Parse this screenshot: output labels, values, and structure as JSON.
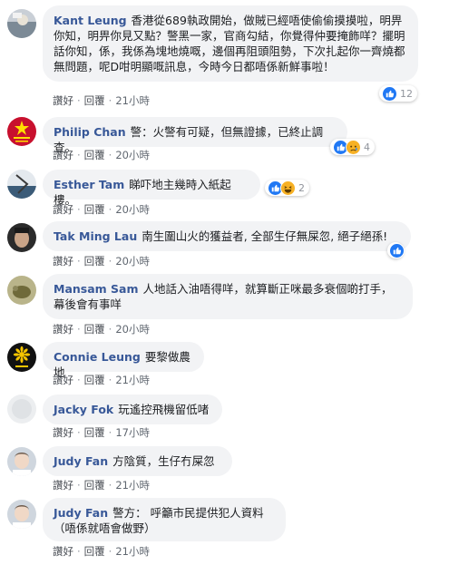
{
  "colors": {
    "name": "#385898",
    "bubble": "#f2f3f5",
    "meta": "#606770",
    "like_blue": "#2078f4",
    "haha_yellow": "#f7b125"
  },
  "actions": {
    "like": "讚好",
    "reply": "回覆",
    "dot": "·"
  },
  "comments": [
    {
      "author": "Kant Leung",
      "text": "香港從689執政開始，做賊已經唔使偷偷摸摸啦，明畀你知，明畀你見又點？警黑一家，官商勾結，你覺得仲要掩飾咩？擺明話你知，係，我係為塊地燒嘅，邊個再阻頭阻勢，下次扎起你一齊燒都無問題，呢D咁明顯嘅訊息，今時今日都唔係新鮮事啦！",
      "time": "21小時",
      "reaction_icons": [
        "like-icon"
      ],
      "reaction_count": "12"
    },
    {
      "author": "Philip Chan",
      "text": "警：火警有可疑，但無證據，已終止調查。",
      "time": "20小時",
      "reaction_icons": [
        "like-icon",
        "sad-icon"
      ],
      "reaction_count": "4"
    },
    {
      "author": "Esther Tam",
      "text": "睇吓地主幾時入紙起樓。",
      "time": "20小時",
      "reaction_icons": [
        "like-icon",
        "haha-icon"
      ],
      "reaction_count": "2"
    },
    {
      "author": "Tak Ming Lau",
      "text": "南生圍山火的獲益者, 全部生仔無屎忽, 絕子絕孫!",
      "time": "20小時",
      "reaction_icons": [
        "like-icon"
      ],
      "reaction_count": ""
    },
    {
      "author": "Mansam Sam",
      "text": "人地話入油唔得咩，就算斷正咪最多衰個啲打手，幕後會有事咩",
      "time": "20小時",
      "reaction_icons": [],
      "reaction_count": ""
    },
    {
      "author": "Connie Leung",
      "text": "要黎做農地",
      "time": "21小時",
      "reaction_icons": [],
      "reaction_count": ""
    },
    {
      "author": "Jacky Fok",
      "text": "玩遙控飛機留低啫",
      "time": "17小時",
      "reaction_icons": [],
      "reaction_count": ""
    },
    {
      "author": "Judy Fan",
      "text": "方陰質，生仔冇屎忽",
      "time": "21小時",
      "reaction_icons": [],
      "reaction_count": ""
    },
    {
      "author": "Judy Fan",
      "text": "警方： 呼籲市民提供犯人資料\n（唔係就唔會做野）",
      "time": "21小時",
      "reaction_icons": [],
      "reaction_count": ""
    }
  ]
}
